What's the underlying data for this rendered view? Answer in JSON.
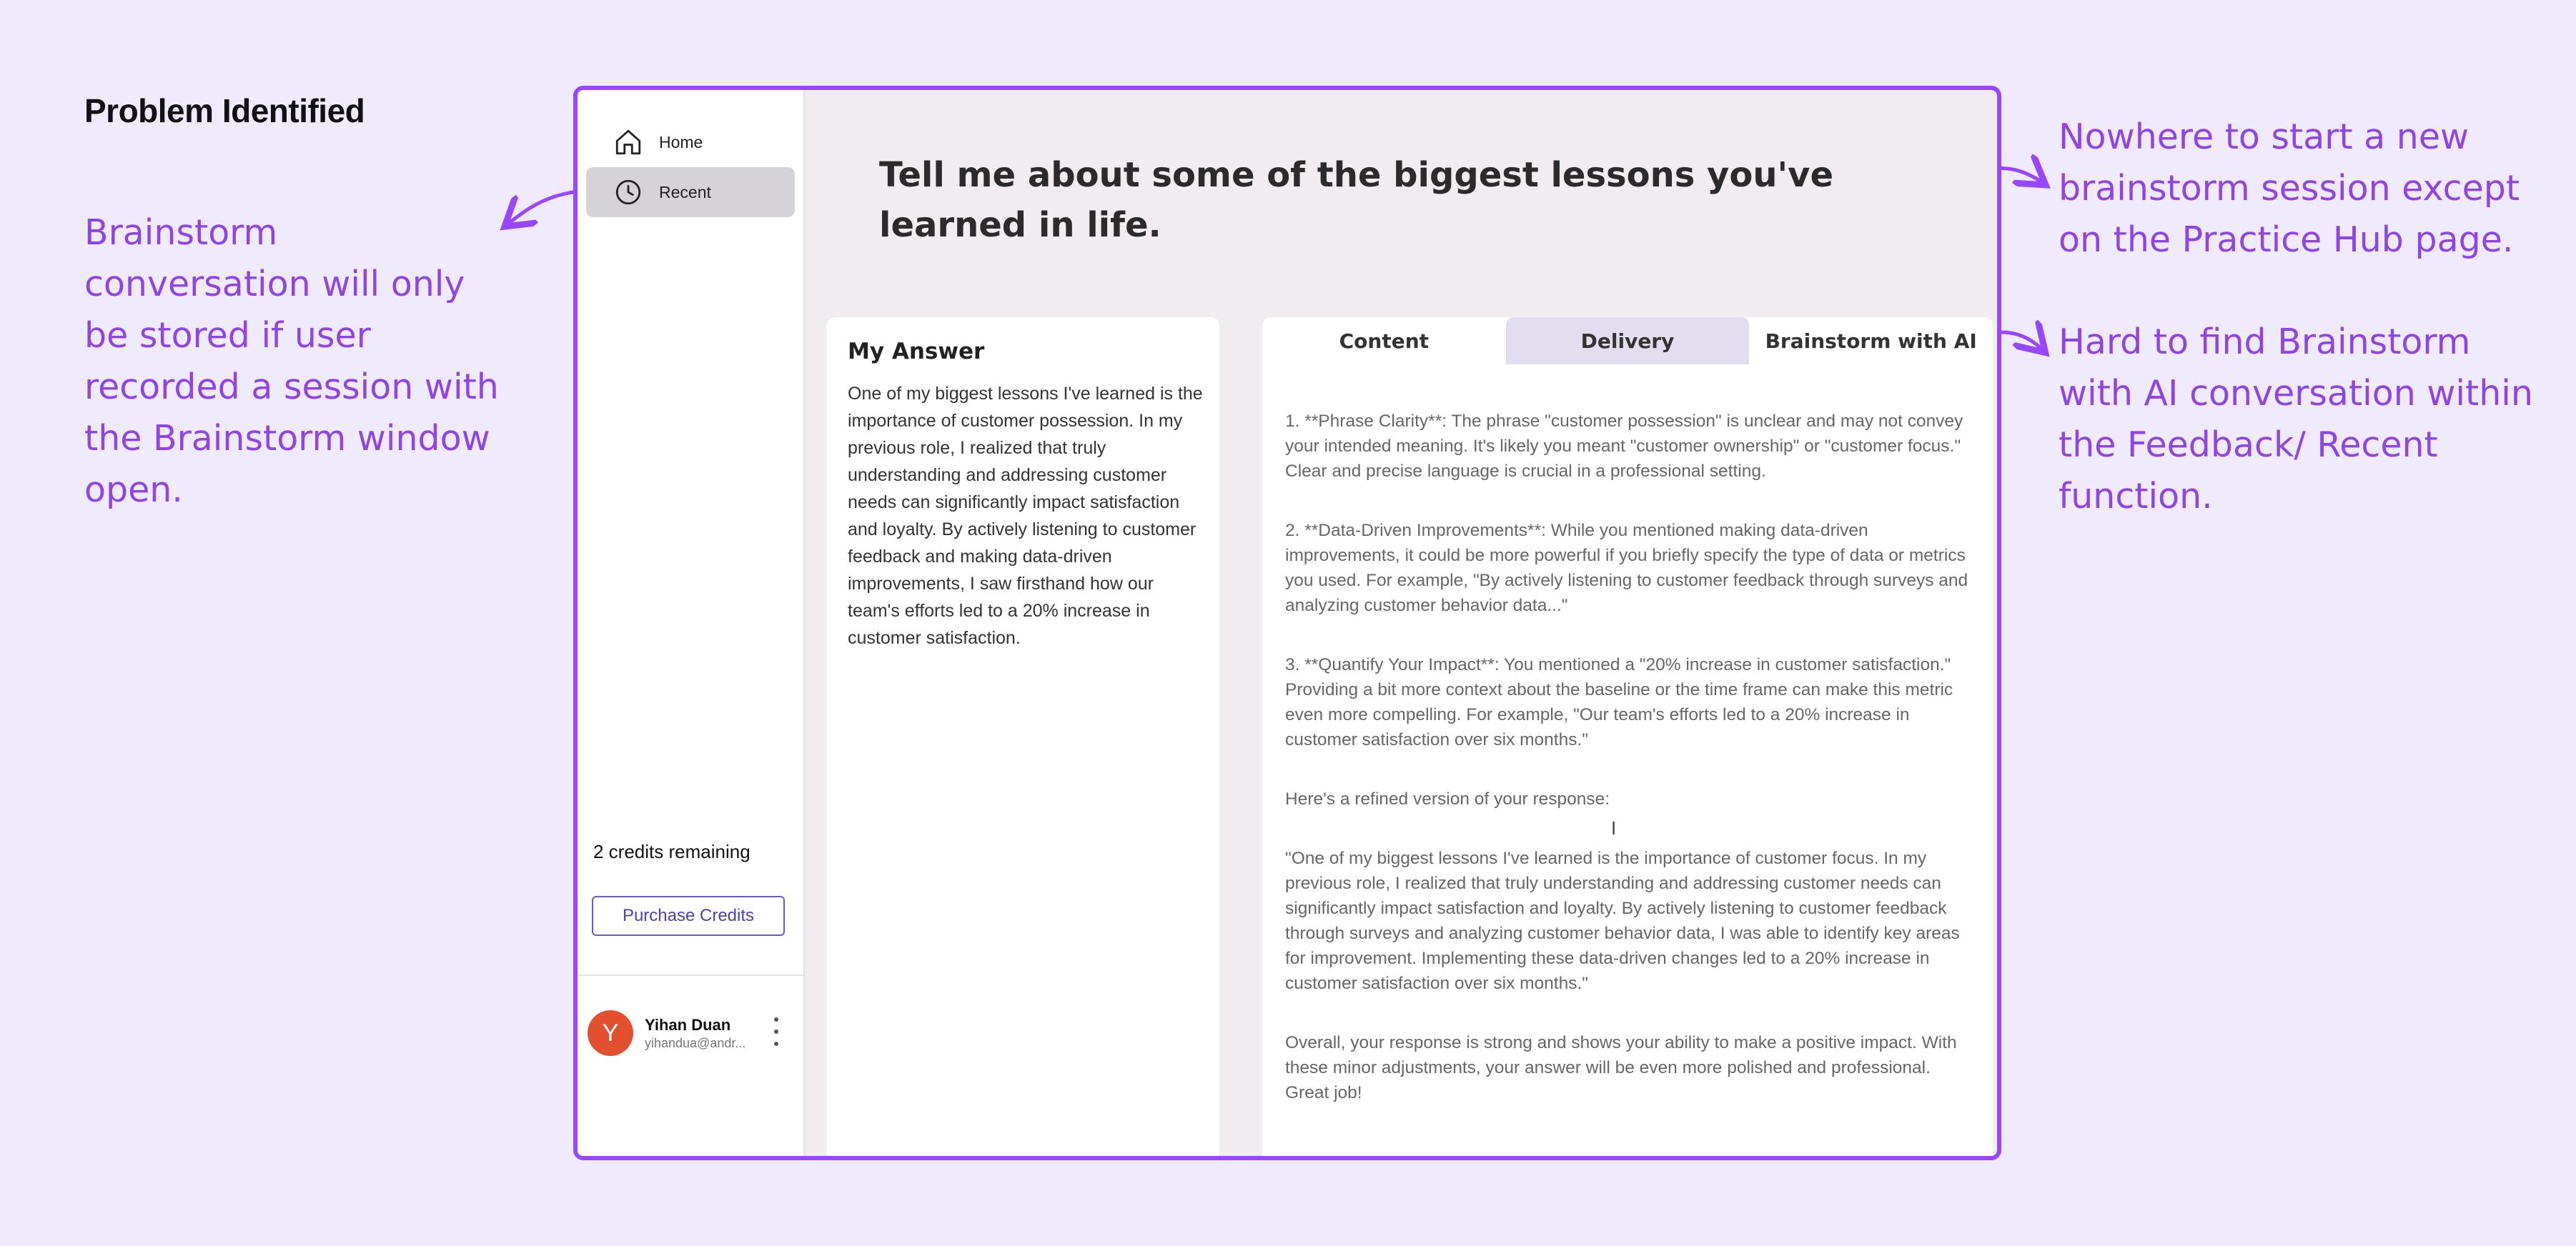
{
  "annotations": {
    "heading": "Problem Identified",
    "left_note": "Brainstorm conversation will only be stored if user recorded a session with the Brainstorm window open.",
    "right_note_1": "Nowhere to start a new brainstorm session except on the Practice Hub page.",
    "right_note_2": "Hard to find Brainstorm with AI conversation within the Feedback/ Recent function."
  },
  "sidebar": {
    "items": [
      {
        "label": "Home",
        "icon": "home-icon"
      },
      {
        "label": "Recent",
        "icon": "clock-icon"
      }
    ],
    "credits_text": "2 credits remaining",
    "purchase_label": "Purchase Credits",
    "user": {
      "initial": "Y",
      "name": "Yihan Duan",
      "email": "yihandua@andr..."
    }
  },
  "main": {
    "question": "Tell me about some of the biggest lessons you've learned in life.",
    "answer": {
      "title": "My Answer",
      "text": "One of my biggest lessons I've learned is the importance of customer possession. In my previous role, I realized that truly understanding and addressing customer needs can significantly impact satisfaction and loyalty. By actively listening to customer feedback and making data-driven improvements, I saw firsthand how our team's efforts led to a 20% increase in customer satisfaction."
    },
    "tabs": [
      "Content",
      "Delivery",
      "Brainstorm with AI"
    ],
    "feedback": [
      "1. **Phrase Clarity**: The phrase \"customer possession\" is unclear and may not convey your intended meaning. It's likely you meant \"customer ownership\" or \"customer focus.\" Clear and precise language is crucial in a professional setting.",
      "2. **Data-Driven Improvements**: While you mentioned making data-driven improvements, it could be more powerful if you briefly specify the type of data or metrics you used. For example, \"By actively listening to customer feedback through surveys and analyzing customer behavior data...\"",
      "3. **Quantify Your Impact**: You mentioned a \"20% increase in customer satisfaction.\" Providing a bit more context about the baseline or the time frame can make this metric even more compelling. For example, \"Our team's efforts led to a 20% increase in customer satisfaction over six months.\"",
      "Here's a refined version of your response:",
      "\"One of my biggest lessons I've learned is the importance of customer focus. In my previous role, I realized that truly understanding and addressing customer needs can significantly impact satisfaction and loyalty. By actively listening to customer feedback through surveys and analyzing customer behavior data, I was able to identify key areas for improvement. Implementing these data-driven changes led to a 20% increase in customer satisfaction over six months.\"",
      "Overall, your response is strong and shows your ability to make a positive impact. With these minor adjustments, your answer will be even more polished and professional. Great job!"
    ]
  },
  "colors": {
    "accent": "#9747ff",
    "annotation": "#8f45e6",
    "avatar": "#e2502f",
    "background": "#efeafc"
  }
}
